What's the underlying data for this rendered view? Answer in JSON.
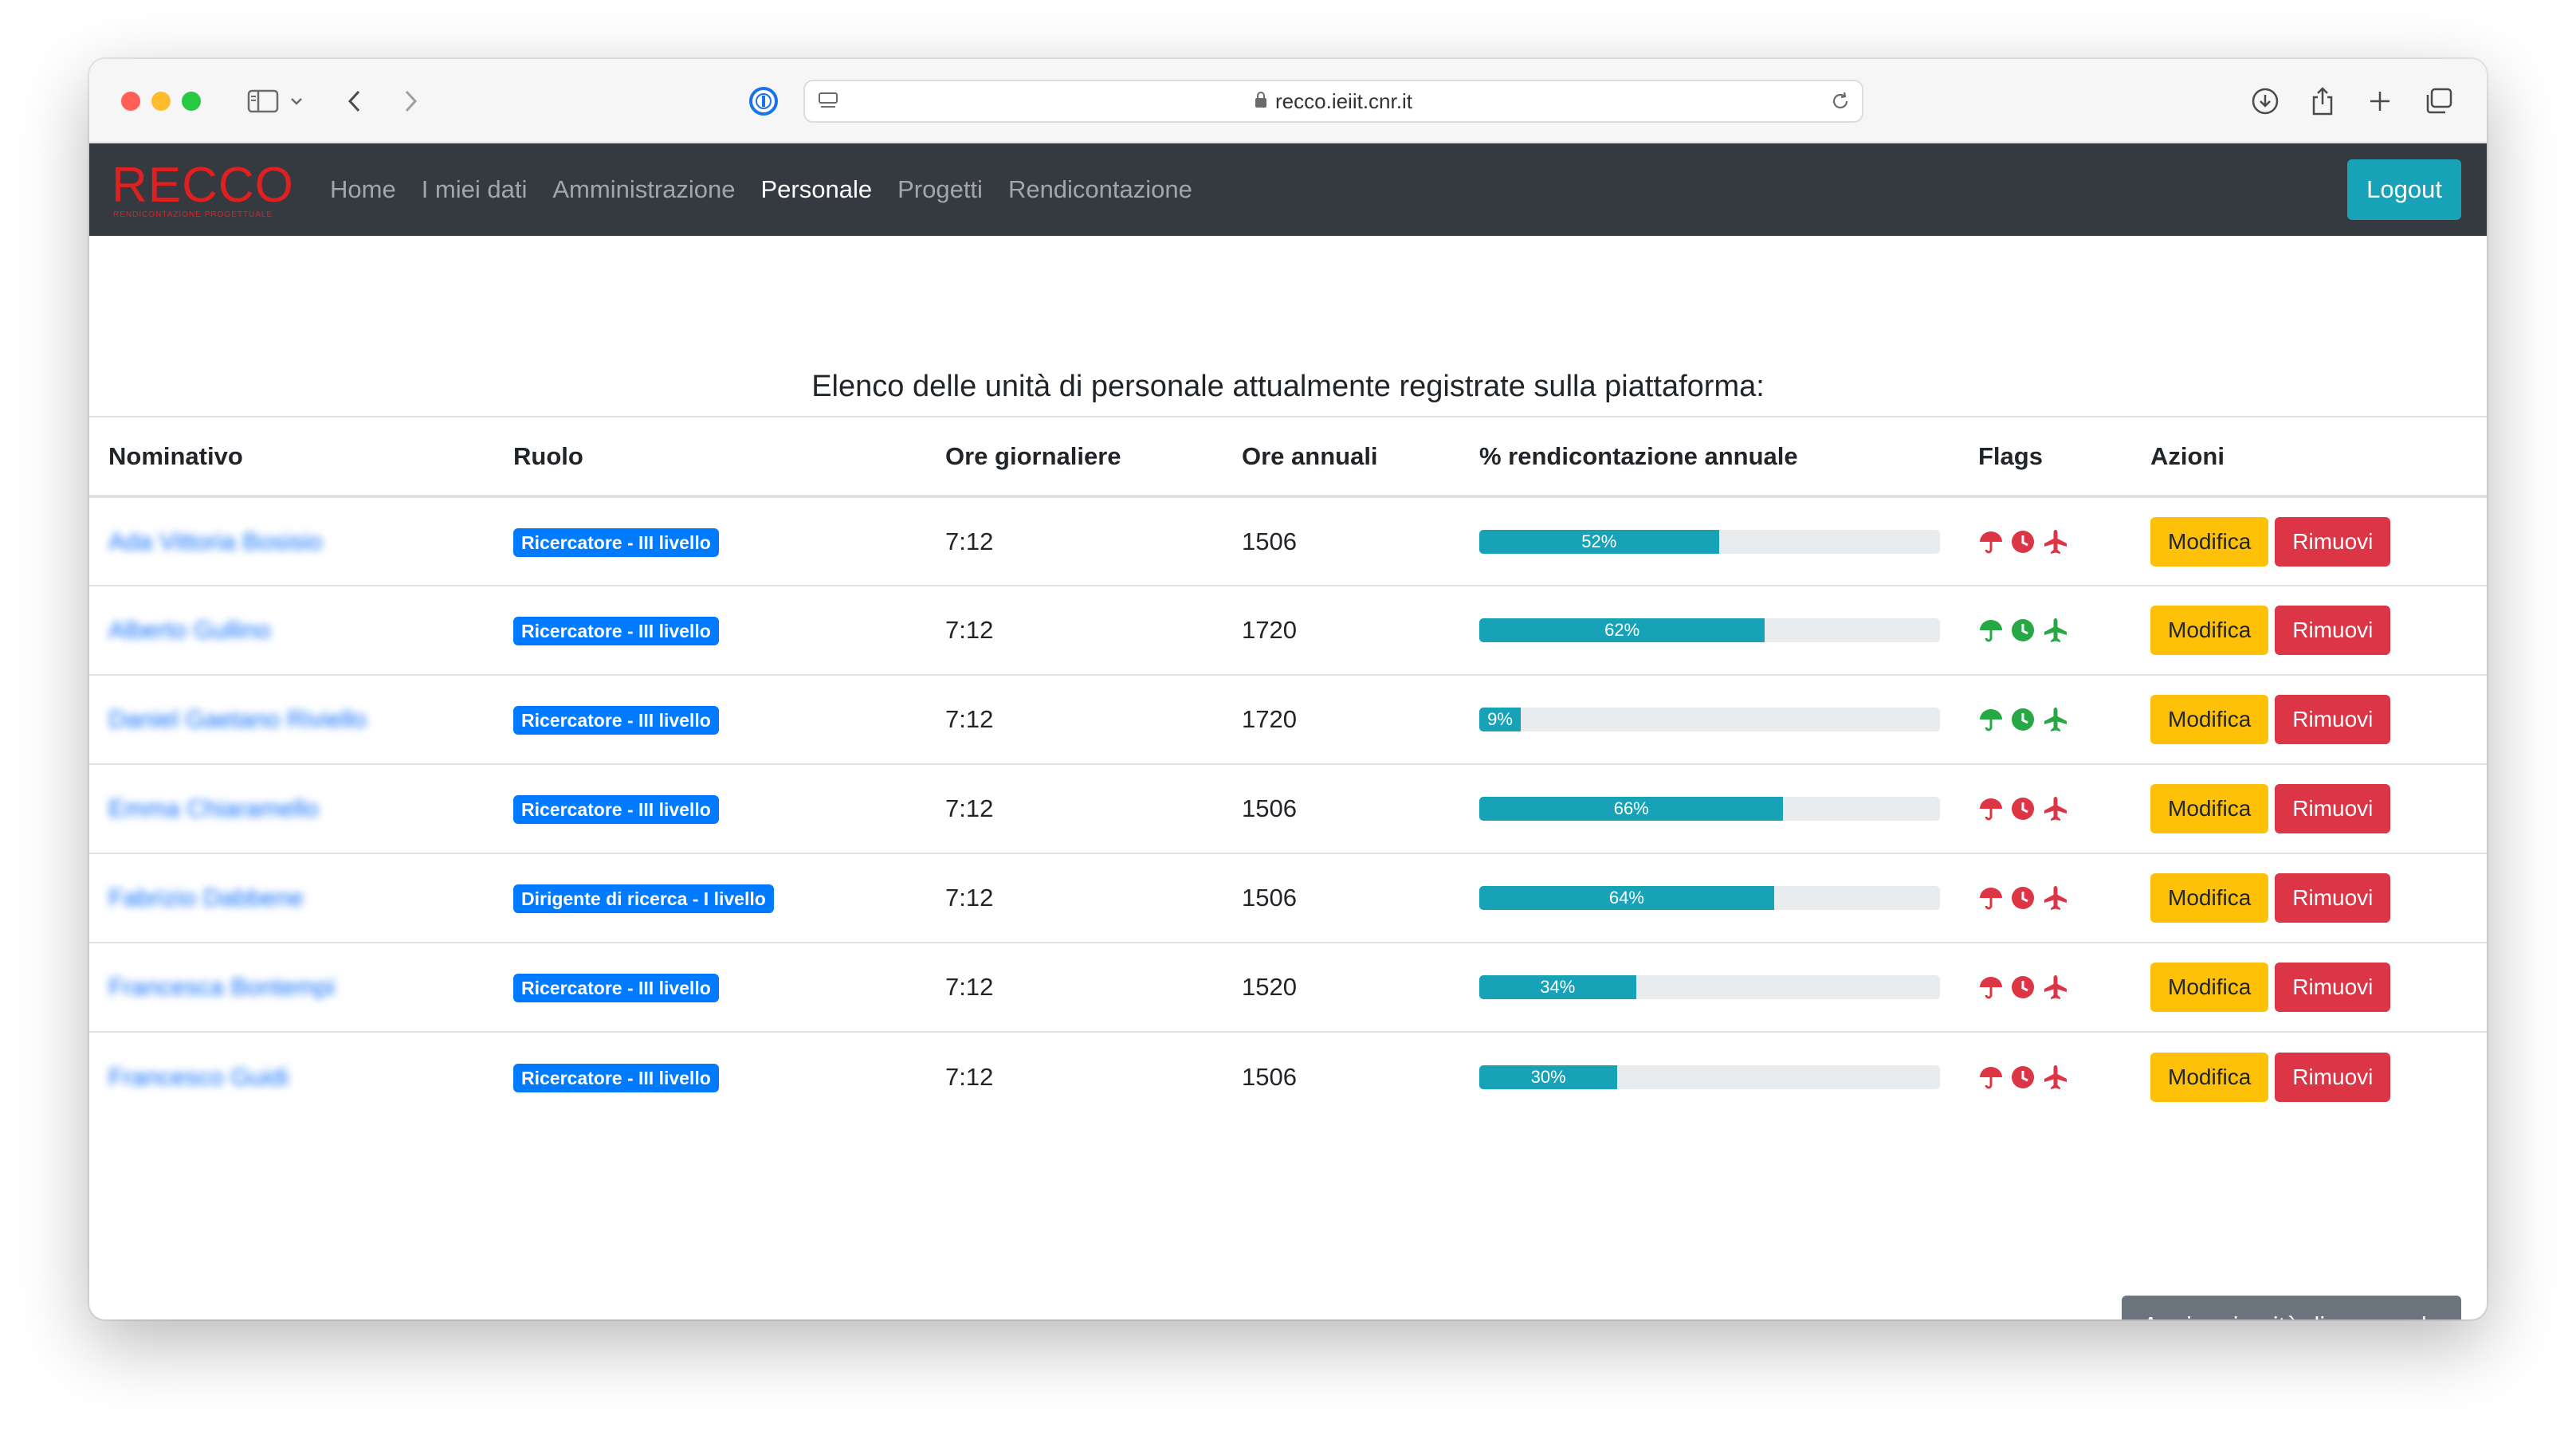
{
  "browser": {
    "url": "recco.ieiit.cnr.it"
  },
  "navbar": {
    "brand": "RECCO",
    "brand_sub": "RENDICONTAZIONE PROGETTUALE",
    "links": [
      "Home",
      "I miei dati",
      "Amministrazione",
      "Personale",
      "Progetti",
      "Rendicontazione"
    ],
    "active": "Personale",
    "logout_label": "Logout"
  },
  "page": {
    "title": "Elenco delle unità di personale attualmente registrate sulla piattaforma:",
    "add_button_label": "Aggiungi unità di personale"
  },
  "table": {
    "headers": [
      "Nominativo",
      "Ruolo",
      "Ore giornaliere",
      "Ore annuali",
      "% rendicontazione annuale",
      "Flags",
      "Azioni"
    ],
    "edit_label": "Modifica",
    "remove_label": "Rimuovi",
    "rows": [
      {
        "name": "Ada Vittoria Bosisio",
        "role": "Ricercatore - III livello",
        "daily_hours": "7:12",
        "annual_hours": "1506",
        "percent": 52,
        "percent_label": "52%",
        "flags": [
          "red",
          "red",
          "red"
        ]
      },
      {
        "name": "Alberto Gullino",
        "role": "Ricercatore - III livello",
        "daily_hours": "7:12",
        "annual_hours": "1720",
        "percent": 62,
        "percent_label": "62%",
        "flags": [
          "green",
          "green",
          "green"
        ]
      },
      {
        "name": "Daniel Gaetano Riviello",
        "role": "Ricercatore - III livello",
        "daily_hours": "7:12",
        "annual_hours": "1720",
        "percent": 9,
        "percent_label": "9%",
        "flags": [
          "green",
          "green",
          "green"
        ]
      },
      {
        "name": "Emma Chiaramello",
        "role": "Ricercatore - III livello",
        "daily_hours": "7:12",
        "annual_hours": "1506",
        "percent": 66,
        "percent_label": "66%",
        "flags": [
          "red",
          "red",
          "red"
        ]
      },
      {
        "name": "Fabrizio Dabbene",
        "role": "Dirigente di ricerca - I livello",
        "daily_hours": "7:12",
        "annual_hours": "1506",
        "percent": 64,
        "percent_label": "64%",
        "flags": [
          "red",
          "red",
          "red"
        ]
      },
      {
        "name": "Francesca Bontempi",
        "role": "Ricercatore - III livello",
        "daily_hours": "7:12",
        "annual_hours": "1520",
        "percent": 34,
        "percent_label": "34%",
        "flags": [
          "red",
          "red",
          "red"
        ]
      },
      {
        "name": "Francesco Guidi",
        "role": "Ricercatore - III livello",
        "daily_hours": "7:12",
        "annual_hours": "1506",
        "percent": 30,
        "percent_label": "30%",
        "flags": [
          "red",
          "red",
          "red"
        ]
      }
    ]
  },
  "colors": {
    "flag_red": "#dc3545",
    "flag_green": "#28a745",
    "progress": "#17a2b8",
    "navbar": "#343a40"
  },
  "icons": {
    "flags": [
      "umbrella-icon",
      "clock-icon",
      "airplane-icon"
    ]
  }
}
